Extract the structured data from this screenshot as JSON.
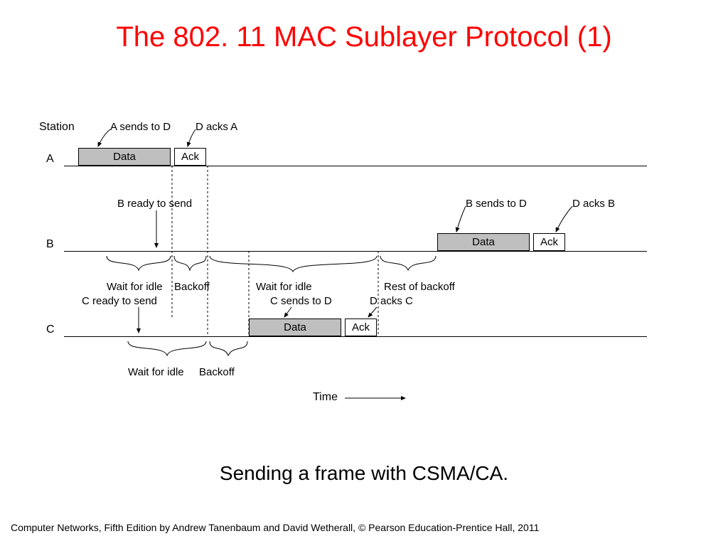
{
  "title": "The 802. 11 MAC Sublayer Protocol (1)",
  "caption": "Sending a frame with CSMA/CA.",
  "footer": "Computer Networks, Fifth Edition by Andrew Tanenbaum and David Wetherall, © Pearson Education-Prentice Hall, 2011",
  "labels": {
    "station_header": "Station",
    "A": "A",
    "B": "B",
    "C": "C",
    "data": "Data",
    "ack": "Ack",
    "time": "Time"
  },
  "annotations": {
    "a_sends": "A sends to D",
    "d_acks_a": "D acks A",
    "b_ready": "B ready to send",
    "b_sends": "B sends to D",
    "d_acks_b": "D acks B",
    "c_ready": "C ready to send",
    "c_sends": "C sends to D",
    "d_acks_c": "D acks C",
    "wait_idle": "Wait for idle",
    "backoff": "Backoff",
    "rest_backoff": "Rest of backoff"
  }
}
